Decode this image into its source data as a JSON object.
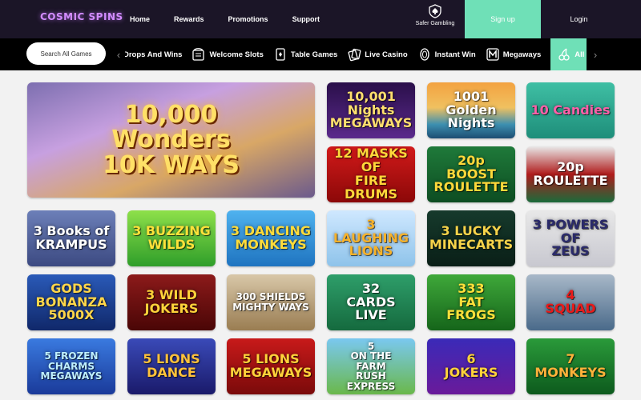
{
  "brand": {
    "logo_text": "COSMIC SPINS"
  },
  "nav": {
    "links": [
      "Home",
      "Rewards",
      "Promotions",
      "Support"
    ],
    "safer_gambling": "Safer Gambling",
    "signup": "Sign up",
    "login": "Login"
  },
  "search": {
    "placeholder": "Search All Games"
  },
  "categories": [
    {
      "label": "Drops And Wins",
      "icon": "drops-icon"
    },
    {
      "label": "Welcome Slots",
      "icon": "slot-machine-icon"
    },
    {
      "label": "Table Games",
      "icon": "cards-icon"
    },
    {
      "label": "Live Casino",
      "icon": "live-casino-icon"
    },
    {
      "label": "Instant Win",
      "icon": "coin-icon"
    },
    {
      "label": "Megaways",
      "icon": "megaways-icon"
    },
    {
      "label": "All Games",
      "icon": "cherries-icon",
      "active": true
    }
  ],
  "games": [
    {
      "title": "10,000\nWonders\n10K WAYS",
      "bg": "linear-gradient(160deg,#7d6fb0 0%,#c7a0e0 35%,#d8a766 65%,#6b5a8c 100%)",
      "fg": "#ffd84a"
    },
    {
      "title": "10,001\nNights\nMEGAWAYS",
      "bg": "linear-gradient(180deg,#2a0f4a,#5b2a8c)",
      "fg": "#ffdf6e"
    },
    {
      "title": "1001 Golden Nights",
      "bg": "linear-gradient(180deg,#f3a240,#f0c160 45%,#3d8fb0 75%,#1c4d72)",
      "fg": "#ffffff"
    },
    {
      "title": "10 Candies",
      "bg": "linear-gradient(180deg,#3fbfa4,#1e8e7a)",
      "fg": "#ff5fa8"
    },
    {
      "title": "12 MASKS OF\nFIRE DRUMS",
      "bg": "linear-gradient(180deg,#d21a1a,#8c0808)",
      "fg": "#ffd83a"
    },
    {
      "title": "20p\nBOOST\nROULETTE",
      "bg": "linear-gradient(180deg,#1f7a3a,#0d4d22)",
      "fg": "#ffd83a"
    },
    {
      "title": "20p ROULETTE",
      "bg": "linear-gradient(180deg,#e8e8e8,#b01c1c 50%,#1a6b3a)",
      "fg": "#ffffff"
    },
    {
      "title": "3 Books of\nKRAMPUS",
      "bg": "linear-gradient(180deg,#6c7fb8,#3c4a82)",
      "fg": "#ffffff"
    },
    {
      "title": "3 BUZZING\nWILDS",
      "bg": "linear-gradient(180deg,#8ee04a,#2f9e2a)",
      "fg": "#ffe23a"
    },
    {
      "title": "3 DANCING\nMONKEYS",
      "bg": "linear-gradient(180deg,#4fb2ef,#1f74c0)",
      "fg": "#ffdc3a"
    },
    {
      "title": "3 LAUGHING\nLIONS",
      "bg": "linear-gradient(180deg,#cfe8ff,#8ec3ea)",
      "fg": "#f7b22a"
    },
    {
      "title": "3 LUCKY\nMINECARTS",
      "bg": "linear-gradient(180deg,#163a2c,#0a1f17)",
      "fg": "#f6d34a"
    },
    {
      "title": "3 POWERS OF\nZEUS",
      "bg": "linear-gradient(180deg,#e8e8e8,#c8c8d0)",
      "fg": "#2a2a6a"
    },
    {
      "title": "GODS\nBONANZA\n5000X",
      "bg": "linear-gradient(180deg,#2a5ab8,#10286a)",
      "fg": "#ffd64a"
    },
    {
      "title": "3 WILD\nJOKERS",
      "bg": "linear-gradient(180deg,#8c1a1a,#4a0606)",
      "fg": "#ffd23a"
    },
    {
      "title": "300 SHIELDS\nMIGHTY WAYS",
      "bg": "linear-gradient(180deg,#d8c7a8,#9a7d52)",
      "fg": "#ffffff"
    },
    {
      "title": "32\nCARDS\nLIVE",
      "bg": "linear-gradient(180deg,#2e9e6a,#156a3e)",
      "fg": "#ffffff"
    },
    {
      "title": "333\nFAT\nFROGS",
      "bg": "linear-gradient(180deg,#3fa83a,#15651a)",
      "fg": "#ffe03a"
    },
    {
      "title": "4\nSQUAD",
      "bg": "linear-gradient(180deg,#a8b8c8,#4a6a8a)",
      "fg": "#e81a1a"
    },
    {
      "title": "5 FROZEN\nCHARMS\nMEGAWAYS",
      "bg": "linear-gradient(180deg,#3a7ae0,#1a3a9a)",
      "fg": "#bff0ff"
    },
    {
      "title": "5 LIONS\nDANCE",
      "bg": "linear-gradient(180deg,#3a4ab8,#1a1a6a)",
      "fg": "#ffc23a"
    },
    {
      "title": "5 LIONS\nMEGAWAYS",
      "bg": "linear-gradient(180deg,#c81a1a,#7a0a0a)",
      "fg": "#ffd23a"
    },
    {
      "title": "5\nON THE\nFARM\nRUSH EXPRESS",
      "bg": "linear-gradient(180deg,#7ac8f0,#6ab84a)",
      "fg": "#ffffff"
    },
    {
      "title": "6\nJOKERS",
      "bg": "linear-gradient(180deg,#3a2ab8,#6a1a9a)",
      "fg": "#ffd23a"
    },
    {
      "title": "7\nMONKEYS",
      "bg": "linear-gradient(180deg,#2a9a3a,#0d5a1d)",
      "fg": "#ffb23a"
    }
  ]
}
